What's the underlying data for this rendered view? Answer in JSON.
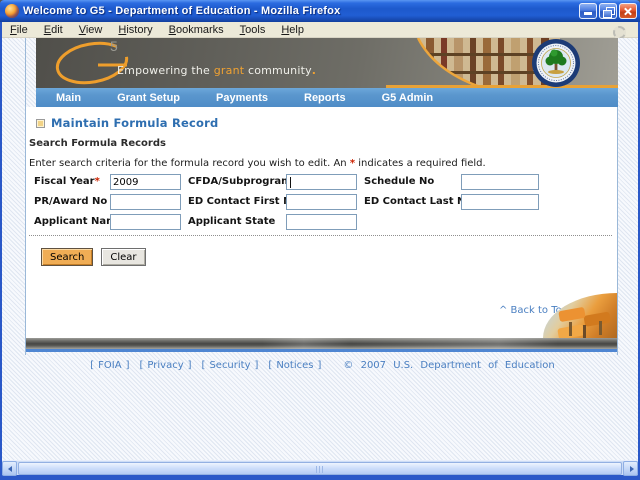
{
  "window": {
    "title": "Welcome to G5 - Department of Education - Mozilla Firefox"
  },
  "menubar": {
    "items": [
      "File",
      "Edit",
      "View",
      "History",
      "Bookmarks",
      "Tools",
      "Help"
    ]
  },
  "banner": {
    "logo_sup": "5",
    "tagline_prefix": "Empowering the ",
    "tagline_highlight": "grant",
    "tagline_suffix": " community",
    "tagline_period": "."
  },
  "nav": {
    "items": [
      "Main",
      "Grant Setup",
      "Payments",
      "Reports",
      "G5 Admin"
    ]
  },
  "page": {
    "title": "Maintain Formula Record",
    "section": "Search Formula Records",
    "instructions": {
      "before": "Enter search criteria for the formula record you wish to edit. An ",
      "star": "*",
      "after": " indicates a required field."
    },
    "form": {
      "required_marker": "*",
      "rows": [
        {
          "cells": [
            {
              "label": "Fiscal Year",
              "value": "2009"
            },
            {
              "label": "CFDA/Subprogram",
              "value": ""
            },
            {
              "label": "Schedule No",
              "value": ""
            }
          ]
        },
        {
          "cells": [
            {
              "label": "PR/Award No",
              "value": ""
            },
            {
              "label": "ED Contact First Name",
              "value": ""
            },
            {
              "label": "ED Contact Last Name",
              "value": ""
            }
          ]
        },
        {
          "cells": [
            {
              "label": "Applicant Name",
              "value": ""
            },
            {
              "label": "Applicant State",
              "value": ""
            }
          ]
        }
      ],
      "buttons": {
        "search": "Search",
        "clear": "Clear"
      }
    },
    "back_to_top": "^ Back to Top"
  },
  "footer": {
    "bracket_open": "[",
    "bracket_close": "]",
    "links": [
      "FOIA",
      "Privacy",
      "Security",
      "Notices"
    ],
    "copyright": "© 2007 U.S. Department of Education"
  },
  "colors": {
    "titlebar_blue": "#1e5bd0",
    "nav_blue": "#5b97ce",
    "accent_orange": "#ef9f2e",
    "link_blue": "#4a7fc1",
    "required_red": "#cc2200",
    "search_button_orange": "#f0ad55"
  }
}
